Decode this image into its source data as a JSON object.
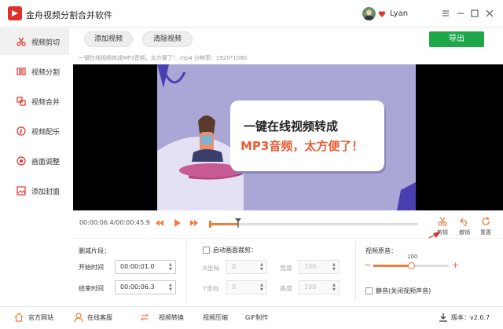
{
  "app": {
    "title": "金舟视频分割合并软件",
    "username": "Lyan"
  },
  "sidebar": {
    "items": [
      {
        "label": "视频剪切",
        "icon": "scissors-icon"
      },
      {
        "label": "视频分割",
        "icon": "split-icon"
      },
      {
        "label": "视频合并",
        "icon": "merge-icon"
      },
      {
        "label": "视频配乐",
        "icon": "music-icon"
      },
      {
        "label": "画面调整",
        "icon": "adjust-icon"
      },
      {
        "label": "添加封面",
        "icon": "image-icon"
      }
    ]
  },
  "toolbar": {
    "add_video": "添加视频",
    "clear_video": "清除视频",
    "export": "导出"
  },
  "file": {
    "info": "一键在线视频转成MP3音频。太方便了！.mp4   分辨率：1920*1080"
  },
  "preview": {
    "line1": "一键在线视频转成",
    "line2": "MP3音频，太方便了！"
  },
  "timeline": {
    "timecode": "00:00:06.4/00:00:45.9",
    "progress": 0.14
  },
  "tools": {
    "cut": "剪辑",
    "undo": "撤销",
    "reset": "重置"
  },
  "clip": {
    "heading": "删减片段：",
    "start_label": "开始时间",
    "start_value": "00:00:01.0",
    "end_label": "结束时间",
    "end_value": "00:00:06.3"
  },
  "crop": {
    "checkbox_label": "启动画面裁剪：",
    "x_label": "X坐标",
    "x_value": "0",
    "y_label": "Y坐标",
    "y_value": "0",
    "w_label": "宽度",
    "w_value": "100",
    "h_label": "高度",
    "h_value": "100"
  },
  "audio": {
    "heading": "视频原音：",
    "volume": "100",
    "volume_fraction": 0.5,
    "minus": "−",
    "plus": "+",
    "mute_label": "静音(关闭视频声音)"
  },
  "footer": {
    "items": [
      "官方网站",
      "在线客服",
      "视频转换",
      "视频压缩",
      "GIF制作"
    ],
    "version": "版本：v2.6.7"
  },
  "colors": {
    "accent": "#f27c3a",
    "export": "#1fa84b",
    "brand": "#e0302a"
  }
}
